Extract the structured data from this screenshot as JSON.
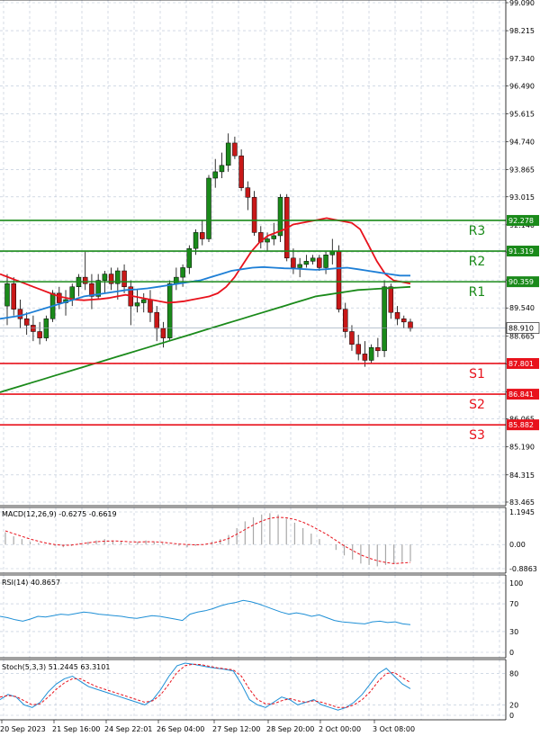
{
  "chart_data": {
    "type": "candlestick",
    "price_axis": {
      "ticks": [
        "99.090",
        "98.215",
        "97.340",
        "96.490",
        "95.615",
        "94.740",
        "93.865",
        "93.015",
        "92.140",
        "91.290",
        "90.415",
        "89.540",
        "88.665",
        "87.790",
        "86.915",
        "86.065",
        "85.190",
        "84.315",
        "83.465"
      ],
      "range": [
        83.465,
        99.09
      ]
    },
    "time_axis": {
      "labels": [
        "20 Sep 2023",
        "21 Sep 16:00",
        "24 Sep 22:01",
        "26 Sep 04:00",
        "27 Sep 12:00",
        "28 Sep 20:00",
        "2 Oct 00:00",
        "3 Oct 08:00"
      ]
    },
    "candles": [
      {
        "o": 89.6,
        "h": 90.6,
        "l": 89.0,
        "c": 90.3
      },
      {
        "o": 90.3,
        "h": 90.5,
        "l": 89.3,
        "c": 89.5
      },
      {
        "o": 89.5,
        "h": 89.8,
        "l": 88.9,
        "c": 89.2
      },
      {
        "o": 89.2,
        "h": 89.4,
        "l": 88.7,
        "c": 89.0
      },
      {
        "o": 89.0,
        "h": 89.3,
        "l": 88.5,
        "c": 88.8
      },
      {
        "o": 88.8,
        "h": 89.1,
        "l": 88.4,
        "c": 88.6
      },
      {
        "o": 88.6,
        "h": 89.3,
        "l": 88.5,
        "c": 89.2
      },
      {
        "o": 89.2,
        "h": 90.1,
        "l": 89.1,
        "c": 90.0
      },
      {
        "o": 90.0,
        "h": 90.2,
        "l": 89.5,
        "c": 89.7
      },
      {
        "o": 89.7,
        "h": 90.1,
        "l": 89.3,
        "c": 89.8
      },
      {
        "o": 89.8,
        "h": 90.3,
        "l": 89.6,
        "c": 90.2
      },
      {
        "o": 90.2,
        "h": 90.6,
        "l": 89.9,
        "c": 90.5
      },
      {
        "o": 90.5,
        "h": 91.3,
        "l": 90.1,
        "c": 90.3
      },
      {
        "o": 90.3,
        "h": 90.6,
        "l": 89.5,
        "c": 89.9
      },
      {
        "o": 89.9,
        "h": 90.6,
        "l": 89.8,
        "c": 90.4
      },
      {
        "o": 90.4,
        "h": 90.7,
        "l": 90.0,
        "c": 90.6
      },
      {
        "o": 90.6,
        "h": 90.8,
        "l": 90.1,
        "c": 90.3
      },
      {
        "o": 90.3,
        "h": 90.8,
        "l": 89.8,
        "c": 90.7
      },
      {
        "o": 90.7,
        "h": 90.9,
        "l": 90.0,
        "c": 90.2
      },
      {
        "o": 90.2,
        "h": 90.4,
        "l": 89.0,
        "c": 89.6
      },
      {
        "o": 89.6,
        "h": 90.1,
        "l": 89.4,
        "c": 89.7
      },
      {
        "o": 89.7,
        "h": 90.0,
        "l": 89.4,
        "c": 89.8
      },
      {
        "o": 89.8,
        "h": 90.1,
        "l": 89.1,
        "c": 89.4
      },
      {
        "o": 89.4,
        "h": 89.6,
        "l": 88.5,
        "c": 88.9
      },
      {
        "o": 88.9,
        "h": 89.1,
        "l": 88.3,
        "c": 88.6
      },
      {
        "o": 88.6,
        "h": 90.4,
        "l": 88.5,
        "c": 90.3
      },
      {
        "o": 90.3,
        "h": 90.8,
        "l": 90.1,
        "c": 90.5
      },
      {
        "o": 90.5,
        "h": 90.9,
        "l": 90.2,
        "c": 90.8
      },
      {
        "o": 90.8,
        "h": 91.5,
        "l": 90.6,
        "c": 91.4
      },
      {
        "o": 91.4,
        "h": 92.0,
        "l": 91.2,
        "c": 91.9
      },
      {
        "o": 91.9,
        "h": 92.3,
        "l": 91.5,
        "c": 91.7
      },
      {
        "o": 91.7,
        "h": 93.7,
        "l": 91.6,
        "c": 93.6
      },
      {
        "o": 93.6,
        "h": 94.2,
        "l": 93.3,
        "c": 93.8
      },
      {
        "o": 93.8,
        "h": 94.4,
        "l": 93.6,
        "c": 94.0
      },
      {
        "o": 94.0,
        "h": 95.0,
        "l": 93.8,
        "c": 94.7
      },
      {
        "o": 94.7,
        "h": 94.9,
        "l": 94.2,
        "c": 94.3
      },
      {
        "o": 94.3,
        "h": 94.5,
        "l": 93.2,
        "c": 93.3
      },
      {
        "o": 93.3,
        "h": 93.5,
        "l": 92.6,
        "c": 93.0
      },
      {
        "o": 93.0,
        "h": 93.2,
        "l": 91.8,
        "c": 91.9
      },
      {
        "o": 91.9,
        "h": 92.1,
        "l": 91.4,
        "c": 91.6
      },
      {
        "o": 91.6,
        "h": 91.9,
        "l": 91.3,
        "c": 91.7
      },
      {
        "o": 91.7,
        "h": 92.2,
        "l": 91.5,
        "c": 91.8
      },
      {
        "o": 91.8,
        "h": 93.1,
        "l": 91.6,
        "c": 93.0
      },
      {
        "o": 93.0,
        "h": 93.1,
        "l": 91.0,
        "c": 91.1
      },
      {
        "o": 91.1,
        "h": 91.4,
        "l": 90.6,
        "c": 90.8
      },
      {
        "o": 90.8,
        "h": 91.1,
        "l": 90.5,
        "c": 90.9
      },
      {
        "o": 90.9,
        "h": 91.2,
        "l": 90.8,
        "c": 91.0
      },
      {
        "o": 91.0,
        "h": 91.2,
        "l": 90.9,
        "c": 91.1
      },
      {
        "o": 91.1,
        "h": 91.2,
        "l": 90.7,
        "c": 90.8
      },
      {
        "o": 90.8,
        "h": 91.3,
        "l": 90.6,
        "c": 91.2
      },
      {
        "o": 91.2,
        "h": 91.7,
        "l": 90.9,
        "c": 91.3
      },
      {
        "o": 91.3,
        "h": 91.5,
        "l": 89.4,
        "c": 89.5
      },
      {
        "o": 89.5,
        "h": 89.7,
        "l": 88.6,
        "c": 88.8
      },
      {
        "o": 88.8,
        "h": 89.0,
        "l": 88.2,
        "c": 88.4
      },
      {
        "o": 88.4,
        "h": 88.7,
        "l": 87.9,
        "c": 88.1
      },
      {
        "o": 88.1,
        "h": 88.5,
        "l": 87.7,
        "c": 87.9
      },
      {
        "o": 87.9,
        "h": 88.4,
        "l": 87.8,
        "c": 88.3
      },
      {
        "o": 88.3,
        "h": 88.6,
        "l": 88.0,
        "c": 88.2
      },
      {
        "o": 88.2,
        "h": 90.4,
        "l": 88.0,
        "c": 90.2
      },
      {
        "o": 90.2,
        "h": 90.3,
        "l": 89.2,
        "c": 89.4
      },
      {
        "o": 89.4,
        "h": 89.6,
        "l": 89.0,
        "c": 89.2
      },
      {
        "o": 89.2,
        "h": 89.3,
        "l": 88.9,
        "c": 89.1
      },
      {
        "o": 89.1,
        "h": 89.2,
        "l": 88.8,
        "c": 88.9
      }
    ],
    "moving_averages": [
      {
        "color": "#e8121c",
        "points": [
          90.6,
          90.5,
          90.4,
          90.3,
          90.2,
          90.1,
          90.0,
          89.9,
          89.85,
          89.8,
          89.78,
          89.8,
          89.82,
          89.85,
          89.9,
          89.95,
          89.9,
          89.85,
          89.8,
          89.75,
          89.7,
          89.72,
          89.75,
          89.8,
          89.85,
          89.9,
          90.0,
          90.2,
          90.5,
          90.9,
          91.3,
          91.6,
          91.8,
          91.9,
          92.0,
          92.15,
          92.2,
          92.25,
          92.3,
          92.35,
          92.3,
          92.25,
          92.2,
          92.0,
          91.5,
          91.0,
          90.6,
          90.4,
          90.35,
          90.3
        ]
      },
      {
        "color": "#1e7fd6",
        "points": [
          89.2,
          89.25,
          89.3,
          89.4,
          89.5,
          89.6,
          89.7,
          89.8,
          89.9,
          89.95,
          90.0,
          90.05,
          90.1,
          90.12,
          90.15,
          90.2,
          90.25,
          90.3,
          90.35,
          90.4,
          90.5,
          90.6,
          90.7,
          90.75,
          90.8,
          90.82,
          90.8,
          90.78,
          90.77,
          90.75,
          90.73,
          90.75,
          90.78,
          90.8,
          90.75,
          90.7,
          90.65,
          90.6,
          90.55,
          90.55
        ]
      },
      {
        "color": "#1a8a1a",
        "points": [
          86.9,
          87.0,
          87.1,
          87.2,
          87.3,
          87.4,
          87.5,
          87.6,
          87.7,
          87.8,
          87.9,
          88.0,
          88.1,
          88.2,
          88.3,
          88.4,
          88.5,
          88.6,
          88.7,
          88.8,
          88.9,
          89.0,
          89.1,
          89.2,
          89.3,
          89.4,
          89.5,
          89.6,
          89.7,
          89.8,
          89.9,
          89.95,
          90.0,
          90.05,
          90.1,
          90.12,
          90.14,
          90.16,
          90.18,
          90.2
        ]
      }
    ],
    "levels": [
      {
        "label": "R3",
        "value": 92.278,
        "tag": "92.278",
        "color": "#1a8a1a"
      },
      {
        "label": "R2",
        "value": 91.319,
        "tag": "91.319",
        "color": "#1a8a1a"
      },
      {
        "label": "R1",
        "value": 90.359,
        "tag": "90.359",
        "color": "#1a8a1a"
      },
      {
        "label": "S1",
        "value": 87.801,
        "tag": "87.801",
        "color": "#e8121c"
      },
      {
        "label": "S2",
        "value": 86.841,
        "tag": "86.841",
        "color": "#e8121c"
      },
      {
        "label": "S3",
        "value": 85.882,
        "tag": "85.882",
        "color": "#e8121c"
      }
    ],
    "current_price": {
      "value": 88.91,
      "tag": "88.910"
    },
    "macd": {
      "title": "MACD(12,26,9) -0.6275 -0.6619",
      "ticks": [
        "1.1945",
        "0.00",
        "-0.8863"
      ],
      "range": [
        -0.8863,
        1.1945
      ],
      "histogram": [
        0.45,
        0.3,
        0.2,
        0.1,
        0.05,
        0.0,
        -0.05,
        -0.1,
        -0.05,
        0.05,
        0.1,
        0.15,
        0.2,
        0.15,
        0.1,
        0.05,
        0.1,
        0.15,
        0.1,
        0.05,
        0.0,
        -0.05,
        -0.1,
        -0.05,
        0.0,
        0.1,
        0.2,
        0.35,
        0.6,
        0.85,
        1.0,
        1.1,
        1.15,
        1.1,
        0.95,
        0.8,
        0.6,
        0.4,
        0.2,
        0.0,
        -0.2,
        -0.4,
        -0.55,
        -0.7,
        -0.75,
        -0.8,
        -0.75,
        -0.7,
        -0.65,
        -0.62
      ],
      "signal": [
        0.5,
        0.4,
        0.3,
        0.2,
        0.12,
        0.05,
        0.0,
        -0.03,
        -0.02,
        0.02,
        0.06,
        0.1,
        0.12,
        0.13,
        0.12,
        0.1,
        0.09,
        0.1,
        0.1,
        0.08,
        0.05,
        0.02,
        0.0,
        -0.01,
        0.0,
        0.05,
        0.12,
        0.22,
        0.38,
        0.55,
        0.72,
        0.86,
        0.96,
        1.0,
        0.98,
        0.92,
        0.82,
        0.68,
        0.52,
        0.35,
        0.15,
        -0.05,
        -0.22,
        -0.38,
        -0.5,
        -0.6,
        -0.66,
        -0.7,
        -0.68,
        -0.66
      ]
    },
    "rsi": {
      "title": "RSI(14) 40.8657",
      "ticks": [
        "100",
        "70",
        "30",
        "0"
      ],
      "range": [
        0,
        100
      ],
      "values": [
        52,
        50,
        47,
        45,
        48,
        52,
        51,
        53,
        55,
        54,
        56,
        58,
        57,
        55,
        54,
        53,
        52,
        50,
        49,
        51,
        53,
        52,
        50,
        48,
        46,
        55,
        58,
        60,
        63,
        67,
        70,
        72,
        75,
        73,
        70,
        66,
        62,
        58,
        55,
        57,
        55,
        52,
        54,
        50,
        46,
        44,
        43,
        42,
        41,
        44,
        45,
        43,
        44,
        41,
        40
      ]
    },
    "stoch": {
      "title": "Stoch(5,3,3) 51.2445 63.3101",
      "ticks": [
        "80",
        "20",
        "0"
      ],
      "range": [
        0,
        100
      ],
      "k": [
        30,
        40,
        35,
        20,
        15,
        25,
        45,
        60,
        70,
        75,
        65,
        55,
        50,
        45,
        40,
        35,
        30,
        25,
        20,
        30,
        50,
        75,
        95,
        100,
        98,
        95,
        92,
        90,
        88,
        85,
        60,
        30,
        20,
        15,
        25,
        35,
        30,
        20,
        25,
        30,
        20,
        15,
        10,
        15,
        25,
        40,
        60,
        80,
        90,
        75,
        60,
        51
      ],
      "d": [
        35,
        38,
        36,
        28,
        20,
        22,
        35,
        50,
        62,
        70,
        70,
        62,
        55,
        50,
        45,
        40,
        35,
        30,
        25,
        28,
        40,
        60,
        82,
        95,
        98,
        97,
        94,
        91,
        89,
        87,
        75,
        50,
        30,
        22,
        22,
        28,
        32,
        28,
        25,
        28,
        25,
        20,
        15,
        15,
        20,
        30,
        45,
        65,
        80,
        82,
        72,
        63
      ]
    }
  }
}
